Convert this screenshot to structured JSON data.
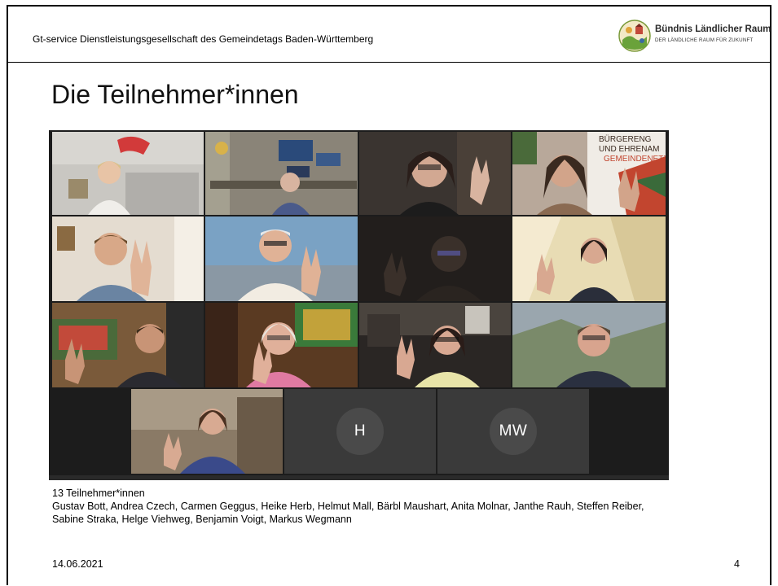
{
  "header": {
    "organization": "Gt-service Dienstleistungsgesellschaft des Gemeindetags Baden-Württemberg",
    "logo_title": "Bündnis Ländlicher Raum",
    "logo_subtitle": "DER LÄNDLICHE RAUM FÜR ZUKUNFT"
  },
  "title": "Die Teilnehmer*innen",
  "video_grid": {
    "avatars": [
      {
        "initials": "H"
      },
      {
        "initials": "MW"
      }
    ],
    "background_text": "BÜRGERENG UND EHRENAM GEMEINDENETZ"
  },
  "caption": {
    "count": "13 Teilnehmer*innen",
    "names": "Gustav Bott, Andrea Czech, Carmen Geggus, Heike Herb, Helmut Mall, Bärbl Maushart, Anita Molnar, Janthe Rauh, Steffen Reiber, Sabine Straka, Helge Viehweg, Benjamin Voigt, Markus Wegmann"
  },
  "footer": {
    "date": "14.06.2021",
    "page": "4"
  },
  "colors": {
    "active_speaker": "#4aa3d6",
    "video_background": "#1c1c1c",
    "avatar_tile": "#3a3a3a"
  }
}
